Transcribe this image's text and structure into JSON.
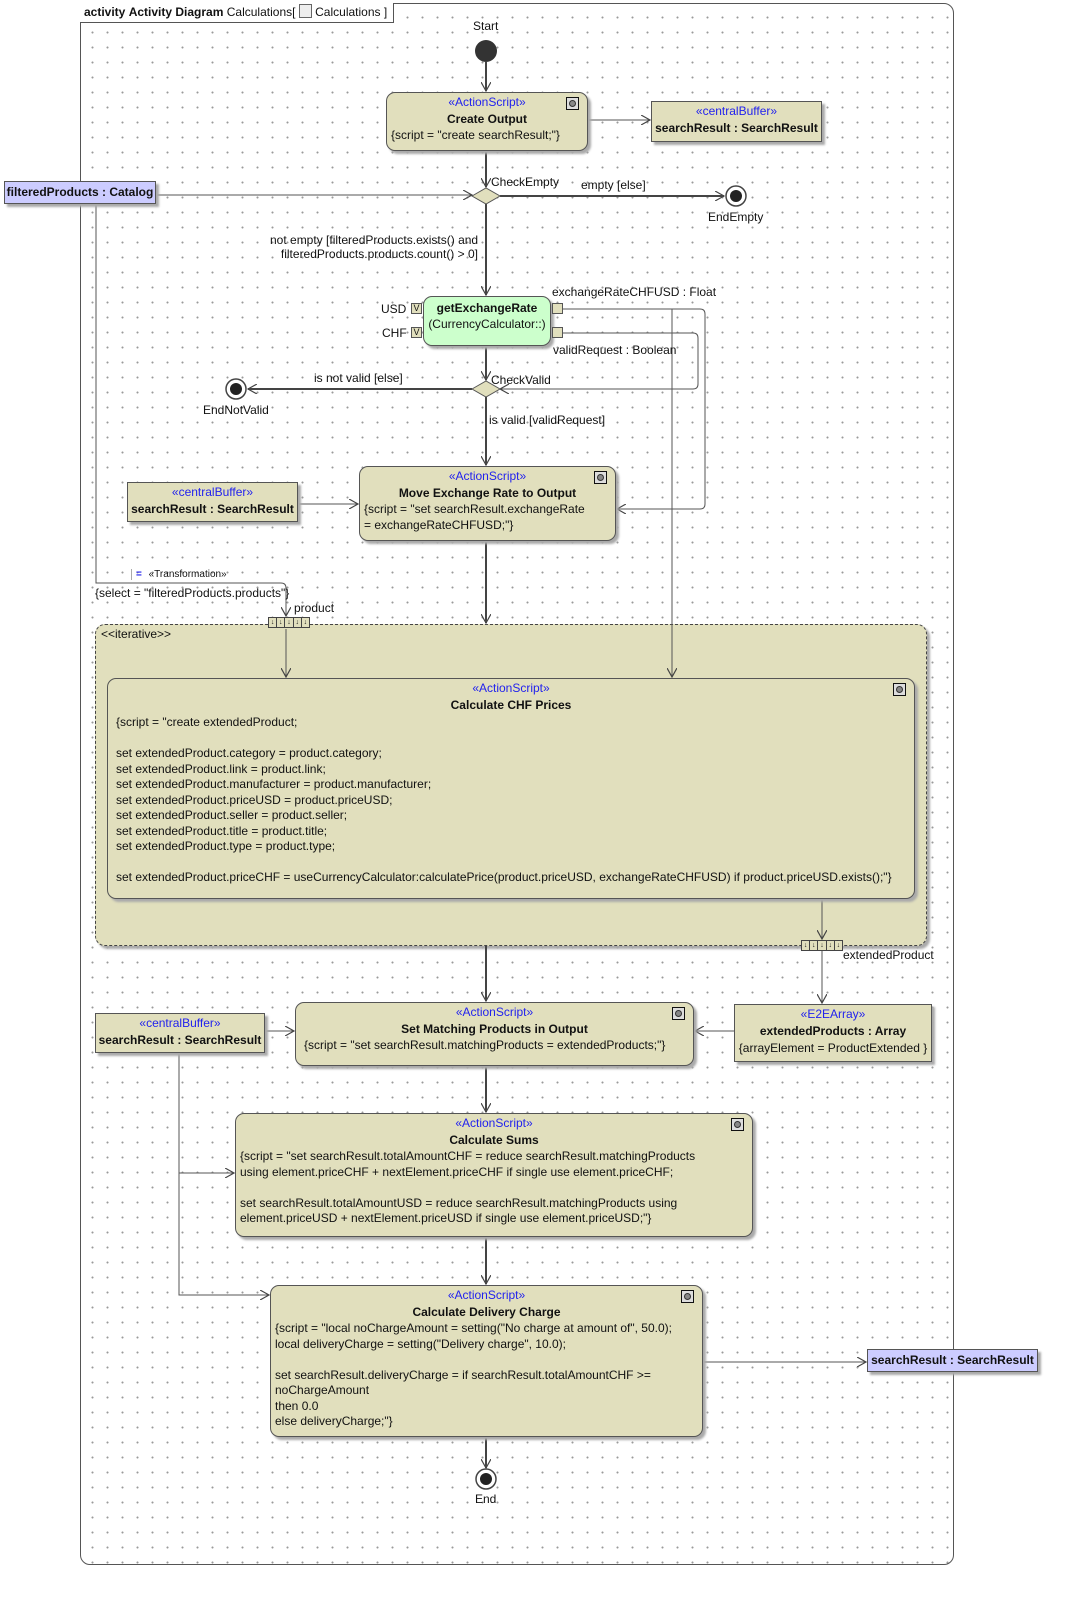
{
  "frame": {
    "kind": "activity",
    "type": "Activity Diagram",
    "name": "Calculations",
    "diagram_ref": "Calculations",
    "diagram-icon": "activity-diagram-icon"
  },
  "colors": {
    "action": "#e1dfbd",
    "call_action": "#ccffcc",
    "parameter": "#ccccff",
    "stereotype": "#2222ee"
  },
  "start": {
    "label": "Start"
  },
  "create_output": {
    "stereotype": "«ActionScript»",
    "title": "Create Output",
    "script": "{script = \"create searchResult;\"}"
  },
  "buffer1": {
    "stereotype": "«centralBuffer»",
    "name": "searchResult : SearchResult"
  },
  "filtered_products": {
    "name": "filteredProducts : Catalog"
  },
  "check_empty": {
    "label": "CheckEmpty",
    "else_guard": "empty [else]",
    "not_empty_guard": [
      "not empty [filteredProducts.exists() and",
      "filteredProducts.products.count() > 0]"
    ]
  },
  "end_empty": {
    "label": "EndEmpty"
  },
  "get_exchange_rate": {
    "title": "getExchangeRate",
    "subtitle": "(CurrencyCalculator::)",
    "in_pins": [
      "USD",
      "CHF"
    ],
    "out_pins": [
      "exchangeRateCHFUSD : Float",
      "validRequest : Boolean"
    ]
  },
  "check_valid": {
    "label": "CheckValid",
    "else_guard": "is not valid [else]",
    "valid_guard": "is valid [validRequest]"
  },
  "end_not_valid": {
    "label": "EndNotValid"
  },
  "move_rate": {
    "stereotype": "«ActionScript»",
    "title": "Move Exchange Rate to Output",
    "script": [
      "{script = \"set searchResult.exchangeRate",
      "= exchangeRateCHFUSD;\"}"
    ]
  },
  "buffer2": {
    "stereotype": "«centralBuffer»",
    "name": "searchResult : SearchResult"
  },
  "transformation": {
    "stereotype": "«Transformation»",
    "select": "{select = \"filteredProducts.products\"}",
    "input_label": "product"
  },
  "region": {
    "label": "<<iterative>>",
    "output_label": "extendedProduct"
  },
  "calc_chf": {
    "stereotype": "«ActionScript»",
    "title": "Calculate CHF Prices",
    "script": [
      "{script = \"create extendedProduct;",
      "",
      "set extendedProduct.category = product.category;",
      "set extendedProduct.link = product.link;",
      "set extendedProduct.manufacturer = product.manufacturer;",
      "set extendedProduct.priceUSD = product.priceUSD;",
      "set extendedProduct.seller = product.seller;",
      "set extendedProduct.title = product.title;",
      "set extendedProduct.type = product.type;",
      "",
      "set extendedProduct.priceCHF = useCurrencyCalculator:calculatePrice(product.priceUSD, exchangeRateCHFUSD) if product.priceUSD.exists();\"}"
    ]
  },
  "set_matching": {
    "stereotype": "«ActionScript»",
    "title": "Set Matching Products in Output",
    "script": "{script = \"set searchResult.matchingProducts = extendedProducts;\"}"
  },
  "buffer3": {
    "stereotype": "«centralBuffer»",
    "name": "searchResult : SearchResult"
  },
  "e2e_array": {
    "stereotype": "«E2EArray»",
    "name": "extendedProducts : Array",
    "tag": "{arrayElement = ProductExtended }"
  },
  "calc_sums": {
    "stereotype": "«ActionScript»",
    "title": "Calculate Sums",
    "script": [
      "{script = \"set searchResult.totalAmountCHF = reduce searchResult.matchingProducts",
      "using element.priceCHF + nextElement.priceCHF if single use element.priceCHF;",
      "",
      "set searchResult.totalAmountUSD = reduce searchResult.matchingProducts using",
      "element.priceUSD + nextElement.priceUSD if single use element.priceUSD;\"}"
    ]
  },
  "calc_delivery": {
    "stereotype": "«ActionScript»",
    "title": "Calculate Delivery Charge",
    "script": [
      "{script = \"local noChargeAmount = setting(\"No charge at amount of\", 50.0);",
      "local deliveryCharge = setting(\"Delivery charge\", 10.0);",
      "",
      "set searchResult.deliveryCharge = if searchResult.totalAmountCHF >=",
      "noChargeAmount",
      "then 0.0",
      "else deliveryCharge;\"}"
    ]
  },
  "search_result_out": {
    "name": "searchResult : SearchResult"
  },
  "end": {
    "label": "End"
  }
}
